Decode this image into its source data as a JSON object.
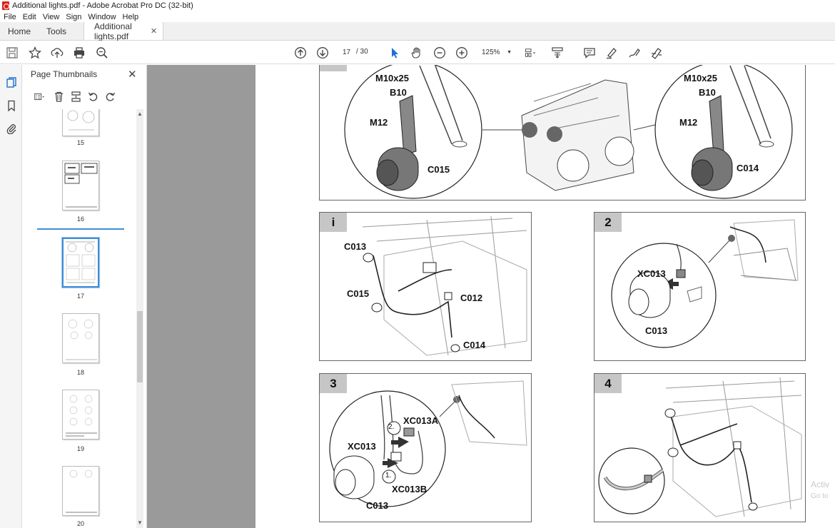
{
  "window": {
    "title": "Additional lights.pdf - Adobe Acrobat Pro DC (32-bit)"
  },
  "menu": [
    "File",
    "Edit",
    "View",
    "Sign",
    "Window",
    "Help"
  ],
  "tabs": {
    "home": "Home",
    "tools": "Tools",
    "document": "Additional lights.pdf"
  },
  "toolbar": {
    "current_page": "17",
    "total_pages": "/ 30",
    "zoom": "125%",
    "icons": [
      "save-icon",
      "bookmark-star-icon",
      "upload-icon",
      "print-icon",
      "zoom-search-icon",
      "page-up-icon",
      "page-down-icon",
      "select-arrow-icon",
      "hand-icon",
      "zoom-out-icon",
      "zoom-in-icon",
      "page-fit-icon",
      "scroll-mode-icon",
      "comment-icon",
      "highlight-icon",
      "draw-icon",
      "fill-sign-icon"
    ]
  },
  "thumbnails": {
    "title": "Page Thumbnails",
    "pages": [
      {
        "label": "15"
      },
      {
        "label": "16"
      },
      {
        "label": "17",
        "selected": true
      },
      {
        "label": "18"
      },
      {
        "label": "19"
      },
      {
        "label": "20"
      }
    ]
  },
  "document": {
    "top_panel": {
      "left_labels": [
        "M10x25",
        "B10",
        "M12",
        "C015"
      ],
      "right_labels": [
        "M10x25",
        "B10",
        "M12",
        "C014"
      ]
    },
    "panel_i": {
      "num": "i",
      "labels": [
        "C013",
        "C015",
        "C012",
        "C014"
      ]
    },
    "panel_2": {
      "num": "2",
      "labels": [
        "XC013",
        "C013"
      ]
    },
    "panel_3": {
      "num": "3",
      "labels": [
        "XC013A",
        "XC013",
        "XC013B",
        "C013"
      ],
      "steps": [
        "2.",
        "1."
      ]
    },
    "panel_4": {
      "num": "4"
    }
  },
  "watermark": {
    "line1": "Activ",
    "line2": "Go to"
  },
  "colors": {
    "selection": "#3c8dd6",
    "panel_num_bg": "#c6c6c6",
    "doc_bg": "#9a9a9a"
  }
}
